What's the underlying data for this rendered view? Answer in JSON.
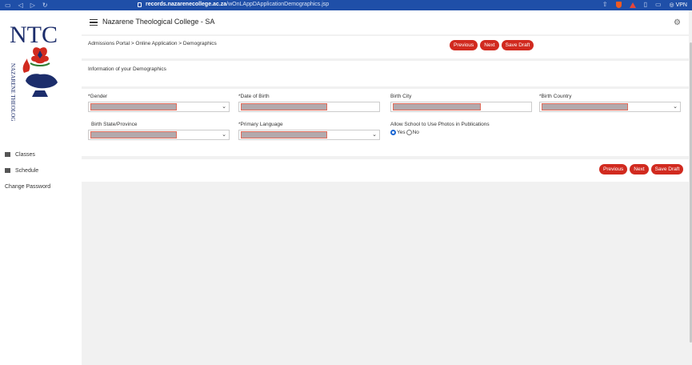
{
  "browser": {
    "url_host": "records.nazarenecollege.ac.za",
    "url_path": "/wOnLAppDApplicationDemographics.jsp",
    "vpn_label": "VPN"
  },
  "sidebar": {
    "logo_monogram": "NTC",
    "logo_text": "NAZARENE THEOLOGICAL COLLEGE",
    "items": [
      {
        "label": "Classes"
      },
      {
        "label": "Schedule"
      },
      {
        "label": "Change Password"
      }
    ]
  },
  "header": {
    "title": "Nazarene Theological College - SA"
  },
  "breadcrumb": "Admissions Portal > Online Application > Demographics",
  "buttons": {
    "previous": "Previous",
    "next": "Next",
    "save_draft": "Save Draft"
  },
  "section_title": "Information of your Demographics",
  "form": {
    "gender_label": "*Gender",
    "dob_label": "*Date of Birth",
    "birth_city_label": "Birth City",
    "birth_country_label": "*Birth Country",
    "birth_state_label": "Birth State/Province",
    "primary_language_label": "*Primary Language",
    "photos_label": "Allow School to Use Photos in Publications",
    "photos_yes": "Yes",
    "photos_no": "No",
    "photos_selected": "Yes"
  },
  "colors": {
    "browser_bar": "#1f4fa8",
    "accent_button": "#d12a1f",
    "logo_navy": "#1c2d6b"
  }
}
